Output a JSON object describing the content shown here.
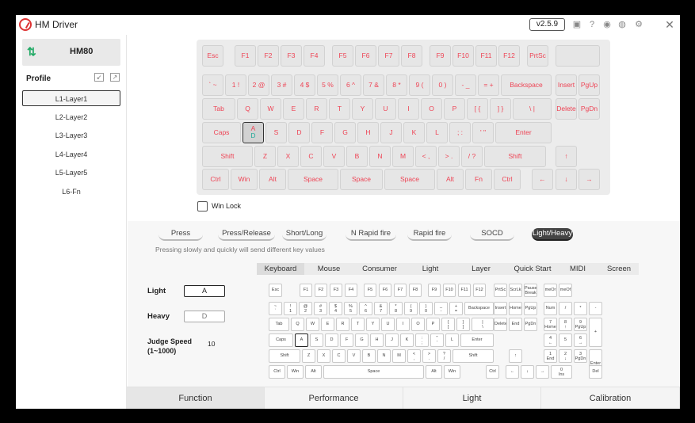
{
  "app": {
    "title": "HM Driver",
    "version": "v2.5.9",
    "close": "✕"
  },
  "title_icons": [
    {
      "name": "image-icon",
      "glyph": "▣"
    },
    {
      "name": "help-icon",
      "glyph": "?"
    },
    {
      "name": "gamepad-icon",
      "glyph": "◉"
    },
    {
      "name": "globe-icon",
      "glyph": "◍"
    },
    {
      "name": "gear-icon",
      "glyph": "⚙"
    }
  ],
  "sidebar": {
    "device": "HM80",
    "device_icon": "⇅",
    "profile_label": "Profile",
    "layers": [
      "L1-Layer1",
      "L2-Layer2",
      "L3-Layer3",
      "L4-Layer4",
      "L5-Layer5",
      "L6-Fn"
    ],
    "selected_layer": "L1-Layer1"
  },
  "keyboard": {
    "rows": [
      [
        [
          "Esc",
          0,
          27
        ],
        [
          "F1",
          41,
          27
        ],
        [
          "F2",
          70,
          27
        ],
        [
          "F3",
          99,
          27
        ],
        [
          "F4",
          128,
          27
        ],
        [
          "F5",
          164,
          27
        ],
        [
          "F6",
          193,
          27
        ],
        [
          "F7",
          222,
          27
        ],
        [
          "F8",
          251,
          27
        ],
        [
          "F9",
          287,
          27
        ],
        [
          "F10",
          316,
          27
        ],
        [
          "F11",
          345,
          27
        ],
        [
          "F12",
          374,
          27
        ],
        [
          "PrtSc",
          410,
          27
        ],
        [
          "",
          446,
          56
        ]
      ],
      [
        [
          "` ~",
          0,
          27
        ],
        [
          "1 !",
          29,
          27
        ],
        [
          "2 @",
          58,
          27
        ],
        [
          "3 #",
          87,
          27
        ],
        [
          "4 $",
          116,
          27
        ],
        [
          "5 %",
          145,
          27
        ],
        [
          "6 ^",
          174,
          27
        ],
        [
          "7 &",
          203,
          27
        ],
        [
          "8 *",
          232,
          27
        ],
        [
          "9 (",
          261,
          27
        ],
        [
          "0 )",
          290,
          27
        ],
        [
          "- _",
          319,
          27
        ],
        [
          "= +",
          348,
          27
        ],
        [
          "Backspace",
          377,
          64
        ],
        [
          "Insert",
          446,
          27
        ],
        [
          "PgUp",
          475,
          27
        ]
      ],
      [
        [
          "Tab",
          0,
          42
        ],
        [
          "Q",
          44,
          27
        ],
        [
          "W",
          73,
          27
        ],
        [
          "E",
          102,
          27
        ],
        [
          "R",
          131,
          27
        ],
        [
          "T",
          160,
          27
        ],
        [
          "Y",
          189,
          27
        ],
        [
          "U",
          218,
          27
        ],
        [
          "I",
          247,
          27
        ],
        [
          "O",
          276,
          27
        ],
        [
          "P",
          305,
          27
        ],
        [
          "[ {",
          334,
          27
        ],
        [
          "] }",
          363,
          27
        ],
        [
          "\\ |",
          392,
          49
        ],
        [
          "Delete",
          446,
          27
        ],
        [
          "PgDn",
          475,
          27
        ]
      ],
      [
        [
          "Caps",
          0,
          49
        ],
        [
          "A",
          51,
          27
        ],
        [
          "S",
          80,
          27
        ],
        [
          "D",
          109,
          27
        ],
        [
          "F",
          138,
          27
        ],
        [
          "G",
          167,
          27
        ],
        [
          "H",
          196,
          27
        ],
        [
          "J",
          225,
          27
        ],
        [
          "K",
          254,
          27
        ],
        [
          "L",
          283,
          27
        ],
        [
          "; :",
          312,
          27
        ],
        [
          "' \"",
          341,
          27
        ],
        [
          "Enter",
          370,
          71
        ]
      ],
      [
        [
          "Shift",
          0,
          64
        ],
        [
          "Z",
          66,
          27
        ],
        [
          "X",
          95,
          27
        ],
        [
          "C",
          124,
          27
        ],
        [
          "V",
          153,
          27
        ],
        [
          "B",
          182,
          27
        ],
        [
          "N",
          211,
          27
        ],
        [
          "M",
          240,
          27
        ],
        [
          "< ,",
          269,
          27
        ],
        [
          "> .",
          298,
          27
        ],
        [
          "/ ?",
          327,
          27
        ],
        [
          "Shift",
          356,
          78
        ],
        [
          "↑",
          446,
          27
        ]
      ],
      [
        [
          "Ctrl",
          0,
          34
        ],
        [
          "Win",
          36,
          34
        ],
        [
          "Alt",
          72,
          34
        ],
        [
          "Space",
          108,
          64
        ],
        [
          "Space",
          174,
          54
        ],
        [
          "Space",
          230,
          64
        ],
        [
          "Alt",
          296,
          34
        ],
        [
          "Fn",
          332,
          34
        ],
        [
          "Ctrl",
          368,
          34
        ],
        [
          "←",
          416,
          27
        ],
        [
          "↓",
          446,
          27
        ],
        [
          "→",
          475,
          27
        ]
      ]
    ],
    "selected_key": {
      "row": 3,
      "index": 1,
      "top": "A",
      "sub": "D"
    },
    "win_lock": "Win Lock"
  },
  "modes": [
    [
      "Press",
      false
    ],
    [
      "Press/Release",
      false
    ],
    [
      "Short/Long",
      false
    ],
    [
      "N Rapid fire",
      false
    ],
    [
      "Rapid fire",
      false
    ],
    [
      "SOCD",
      false
    ],
    [
      "Light/Heavy",
      true
    ]
  ],
  "hint": "Pressing slowly and quickly will send different key values",
  "settings": {
    "light_label": "Light",
    "light_value": "A",
    "heavy_label": "Heavy",
    "heavy_value": "D",
    "judge_label": "Judge Speed\n(1~1000)",
    "judge_value": "10"
  },
  "key_tabs": [
    "Keyboard",
    "Mouse",
    "Consumer",
    "Light",
    "Layer",
    "Quick Start",
    "MIDI",
    "Screen"
  ],
  "active_key_tab": "Keyboard",
  "small_keys": [
    [
      "Esc",
      0,
      0,
      17,
      1
    ],
    [
      "F1",
      39,
      0,
      16,
      1
    ],
    [
      "F2",
      58,
      0,
      16,
      1
    ],
    [
      "F3",
      77,
      0,
      16,
      1
    ],
    [
      "F4",
      96,
      0,
      16,
      1
    ],
    [
      "F5",
      120,
      0,
      16,
      1
    ],
    [
      "F6",
      139,
      0,
      16,
      1
    ],
    [
      "F7",
      158,
      0,
      16,
      1
    ],
    [
      "F8",
      177,
      0,
      16,
      1
    ],
    [
      "F9",
      201,
      0,
      16,
      1
    ],
    [
      "F10",
      220,
      0,
      16,
      1
    ],
    [
      "F11",
      239,
      0,
      16,
      1
    ],
    [
      "F12",
      258,
      0,
      16,
      1
    ],
    [
      "PrtSc",
      284,
      0,
      17,
      1
    ],
    [
      "ScrLk",
      303,
      0,
      17,
      1
    ],
    [
      "Pause\nBreak",
      322,
      0,
      17,
      1
    ],
    [
      "meOr",
      347,
      0,
      17,
      1
    ],
    [
      "meOf",
      366,
      0,
      17,
      1
    ],
    [
      "~\n`",
      0,
      23,
      17,
      1
    ],
    [
      "!\n1",
      19,
      23,
      17,
      1
    ],
    [
      "@\n2",
      38,
      23,
      17,
      1
    ],
    [
      "#\n3",
      57,
      23,
      17,
      1
    ],
    [
      "$\n4",
      76,
      23,
      17,
      1
    ],
    [
      "%\n5",
      95,
      23,
      17,
      1
    ],
    [
      "^\n6",
      114,
      23,
      17,
      1
    ],
    [
      "&\n7",
      133,
      23,
      17,
      1
    ],
    [
      "*\n8",
      152,
      23,
      17,
      1
    ],
    [
      "(\n9",
      171,
      23,
      17,
      1
    ],
    [
      ")\n0",
      190,
      23,
      17,
      1
    ],
    [
      "_\n-",
      209,
      23,
      17,
      1
    ],
    [
      "+\n=",
      228,
      23,
      17,
      1
    ],
    [
      "Backspace",
      247,
      23,
      37,
      1
    ],
    [
      "Insert",
      284,
      23,
      17,
      1
    ],
    [
      "Home",
      303,
      23,
      17,
      1
    ],
    [
      "PgUp",
      322,
      23,
      17,
      1
    ],
    [
      "Num",
      347,
      23,
      17,
      1
    ],
    [
      "/",
      366,
      23,
      17,
      1
    ],
    [
      "*",
      385,
      23,
      17,
      1
    ],
    [
      "-",
      404,
      23,
      17,
      1
    ],
    [
      "Tab",
      0,
      43,
      26,
      1
    ],
    [
      "Q",
      28,
      43,
      17,
      1
    ],
    [
      "W",
      47,
      43,
      17,
      1
    ],
    [
      "E",
      66,
      43,
      17,
      1
    ],
    [
      "R",
      85,
      43,
      17,
      1
    ],
    [
      "T",
      104,
      43,
      17,
      1
    ],
    [
      "Y",
      123,
      43,
      17,
      1
    ],
    [
      "U",
      142,
      43,
      17,
      1
    ],
    [
      "I",
      161,
      43,
      17,
      1
    ],
    [
      "O",
      180,
      43,
      17,
      1
    ],
    [
      "P",
      199,
      43,
      17,
      1
    ],
    [
      "{\n[",
      218,
      43,
      17,
      1
    ],
    [
      "}\n]",
      237,
      43,
      17,
      1
    ],
    [
      "|\n\\",
      256,
      43,
      28,
      1
    ],
    [
      "Delete",
      284,
      43,
      17,
      1
    ],
    [
      "End",
      303,
      43,
      17,
      1
    ],
    [
      "PgDn",
      322,
      43,
      17,
      1
    ],
    [
      "7\nHome",
      347,
      43,
      17,
      1
    ],
    [
      "8\n↑",
      366,
      43,
      17,
      1
    ],
    [
      "9\nPgUp",
      385,
      43,
      17,
      1
    ],
    [
      "+",
      404,
      43,
      17,
      2
    ],
    [
      "Caps",
      0,
      63,
      31,
      1
    ],
    [
      "A",
      33,
      63,
      17,
      1
    ],
    [
      "S",
      52,
      63,
      17,
      1
    ],
    [
      "D",
      71,
      63,
      17,
      1
    ],
    [
      "F",
      90,
      63,
      17,
      1
    ],
    [
      "G",
      109,
      63,
      17,
      1
    ],
    [
      "H",
      128,
      63,
      17,
      1
    ],
    [
      "J",
      147,
      63,
      17,
      1
    ],
    [
      "K",
      166,
      63,
      17,
      1
    ],
    [
      ":\n;",
      185,
      63,
      17,
      1
    ],
    [
      "\"\n'",
      204,
      63,
      17,
      1
    ],
    [
      "L",
      223,
      63,
      17,
      1
    ],
    [
      "Enter",
      242,
      63,
      42,
      1
    ],
    [
      "4\n←",
      347,
      63,
      17,
      1
    ],
    [
      "5",
      366,
      63,
      17,
      1
    ],
    [
      "6\n→",
      385,
      63,
      17,
      1
    ],
    [
      "Shift",
      0,
      83,
      40,
      1
    ],
    [
      "Z",
      42,
      83,
      17,
      1
    ],
    [
      "X",
      61,
      83,
      17,
      1
    ],
    [
      "C",
      80,
      83,
      17,
      1
    ],
    [
      "V",
      99,
      83,
      17,
      1
    ],
    [
      "B",
      118,
      83,
      17,
      1
    ],
    [
      "N",
      137,
      83,
      17,
      1
    ],
    [
      "M",
      156,
      83,
      17,
      1
    ],
    [
      "<\n,",
      175,
      83,
      17,
      1
    ],
    [
      ">\n.",
      194,
      83,
      17,
      1
    ],
    [
      "?\n/",
      213,
      83,
      17,
      1
    ],
    [
      "Shift",
      232,
      83,
      52,
      1
    ],
    [
      "↑",
      303,
      83,
      17,
      1
    ],
    [
      "1\nEnd",
      347,
      83,
      17,
      1
    ],
    [
      "2\n↓",
      366,
      83,
      17,
      1
    ],
    [
      "3\nPgDn",
      385,
      83,
      17,
      1
    ],
    [
      "Enter",
      404,
      83,
      17,
      2
    ],
    [
      "Ctrl",
      0,
      103,
      21,
      1
    ],
    [
      "Win",
      23,
      103,
      21,
      1
    ],
    [
      "Alt",
      46,
      103,
      21,
      1
    ],
    [
      "Space",
      69,
      103,
      127,
      1
    ],
    [
      "Alt",
      198,
      103,
      21,
      1
    ],
    [
      "Win",
      221,
      103,
      21,
      1
    ],
    [
      "Ctrl",
      274,
      103,
      17,
      1
    ],
    [
      "←",
      299,
      103,
      17,
      1
    ],
    [
      "↓",
      318,
      103,
      17,
      1
    ],
    [
      "→",
      337,
      103,
      17,
      1
    ],
    [
      "0\nIns",
      356,
      103,
      27,
      1
    ],
    [
      "Del",
      404,
      103,
      17,
      1
    ]
  ],
  "bottom_tabs": [
    "Function",
    "Performance",
    "Light",
    "Calibration"
  ],
  "active_bottom_tab": "Function"
}
